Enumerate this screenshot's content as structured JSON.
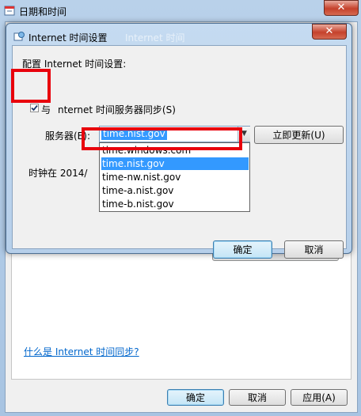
{
  "outer_window": {
    "title": "日期和时间",
    "close": "✕",
    "link": "什么是 Internet 时间同步?",
    "ok": "确定",
    "cancel": "取消",
    "apply": "应用(A)"
  },
  "dialog": {
    "title": "Internet 时间设置",
    "ghost_title": "Internet 时间",
    "close": "✕",
    "heading": "配置 Internet 时间设置:",
    "sync_label_prefix": "与",
    "sync_label_rest": "nternet 时间服务器同步(S)",
    "sync_checked": true,
    "server_label": "服务器(E):",
    "server_value": "time.nist.gov",
    "update_button": "立即更新(U)",
    "clock_text_visible": "时钟在 2014/",
    "ok": "确定",
    "cancel": "取消"
  },
  "dropdown_options": [
    "time.windows.com",
    "time.nist.gov",
    "time-nw.nist.gov",
    "time-a.nist.gov",
    "time-b.nist.gov"
  ],
  "dropdown_selected": "time.nist.gov",
  "colors": {
    "highlight": "#3399ff",
    "annotation": "#e8000c",
    "close": "#c5412b"
  }
}
